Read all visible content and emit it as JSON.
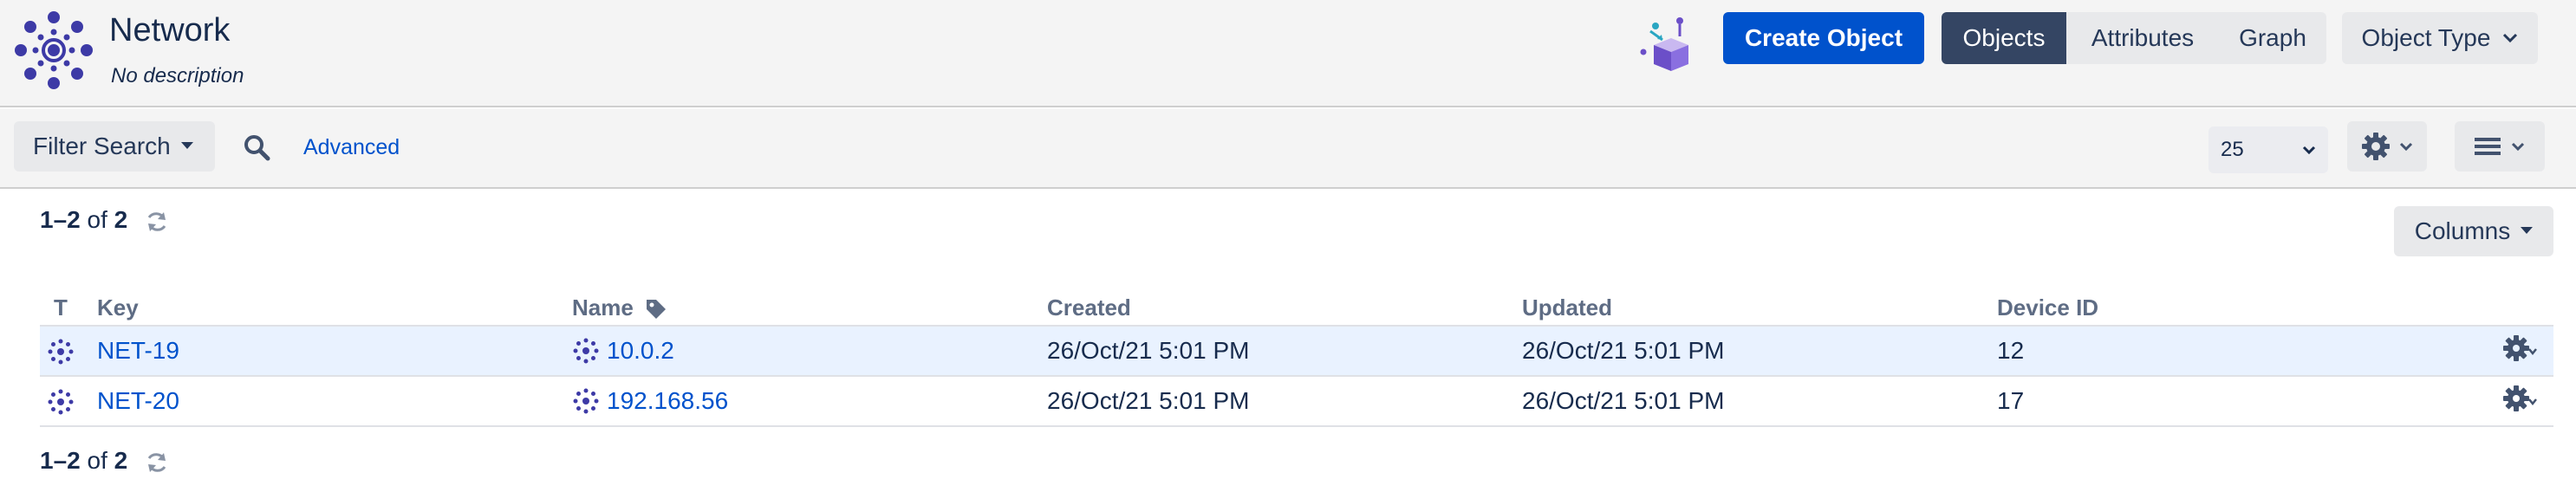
{
  "header": {
    "title": "Network",
    "description": "No description",
    "create_button": "Create Object",
    "view_tabs": [
      "Objects",
      "Attributes",
      "Graph"
    ],
    "active_tab": "Objects",
    "object_type_button": "Object Type"
  },
  "toolbar": {
    "filter_button": "Filter Search",
    "advanced_link": "Advanced",
    "page_size": "25"
  },
  "results": {
    "range": "1–2",
    "of": "of",
    "total": "2",
    "columns_button": "Columns"
  },
  "table": {
    "headers": {
      "type": "T",
      "key": "Key",
      "name": "Name",
      "created": "Created",
      "updated": "Updated",
      "device_id": "Device ID"
    },
    "rows": [
      {
        "key": "NET-19",
        "name": "10.0.2",
        "created": "26/Oct/21 5:01 PM",
        "updated": "26/Oct/21 5:01 PM",
        "device_id": "12",
        "highlighted": true
      },
      {
        "key": "NET-20",
        "name": "192.168.56",
        "created": "26/Oct/21 5:01 PM",
        "updated": "26/Oct/21 5:01 PM",
        "device_id": "17",
        "highlighted": false
      }
    ]
  },
  "icons": {
    "logo": "network-icon",
    "box": "box-icon",
    "search": "search-icon",
    "refresh": "refresh-icon",
    "settings": "gear-icon",
    "list": "list-icon",
    "tag": "tag-icon",
    "row_type": "network-icon",
    "row_action": "gear-icon"
  },
  "colors": {
    "primary": "#0052cc",
    "active_tab": "#344563",
    "row_highlight": "#e9f2ff",
    "link": "#0052cc",
    "network_icon": "#3d3aa6"
  }
}
